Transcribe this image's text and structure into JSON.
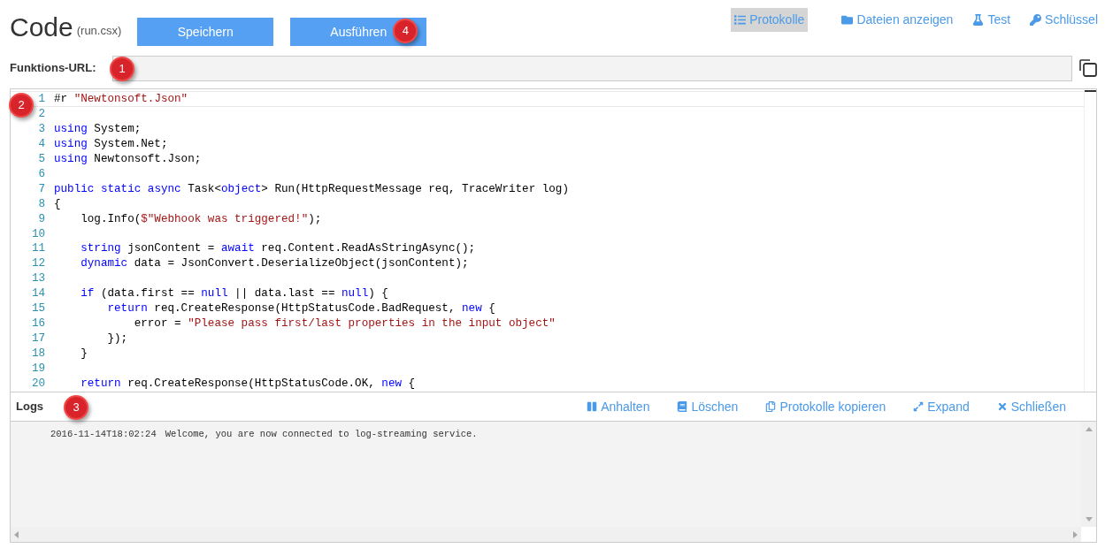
{
  "header": {
    "title": "Code",
    "subtitle": "(run.csx)",
    "buttons": [
      {
        "label": "Speichern"
      },
      {
        "label": "Ausführen",
        "callout": "4"
      }
    ]
  },
  "nav": [
    {
      "label": "Protokolle",
      "selected": true
    },
    {
      "label": "Dateien anzeigen",
      "selected": false
    },
    {
      "label": "Test",
      "selected": false
    },
    {
      "label": "Schlüssel",
      "selected": false
    }
  ],
  "function_url": {
    "label": "Funktions-URL:",
    "callout": "1"
  },
  "editor": {
    "callout": "2",
    "lines": [
      {
        "number": "1",
        "tokens": [
          {
            "kind": "plain",
            "text": "#r "
          },
          {
            "kind": "string",
            "text": "\"Newtonsoft.Json\""
          }
        ]
      },
      {
        "number": "2"
      },
      {
        "number": "3",
        "tokens": [
          {
            "kind": "keyword",
            "text": "using"
          },
          {
            "kind": "plain",
            "text": " System;"
          }
        ]
      },
      {
        "number": "4",
        "tokens": [
          {
            "kind": "keyword",
            "text": "using"
          },
          {
            "kind": "plain",
            "text": " System.Net;"
          }
        ]
      },
      {
        "number": "5",
        "tokens": [
          {
            "kind": "keyword",
            "text": "using"
          },
          {
            "kind": "plain",
            "text": " Newtonsoft.Json;"
          }
        ]
      },
      {
        "number": "6"
      },
      {
        "number": "7",
        "tokens": [
          {
            "kind": "keyword",
            "text": "public"
          },
          {
            "kind": "keyword",
            "text": " static"
          },
          {
            "kind": "keyword",
            "text": " async"
          },
          {
            "kind": "plain",
            "text": " Task<"
          },
          {
            "kind": "keyword",
            "text": "object"
          },
          {
            "kind": "plain",
            "text": "> Run(HttpRequestMessage req, TraceWriter log)"
          }
        ]
      },
      {
        "number": "8",
        "tokens": [
          {
            "kind": "plain",
            "text": "{"
          }
        ]
      },
      {
        "number": "9",
        "tokens": [
          {
            "kind": "plain",
            "text": "    log.Info("
          },
          {
            "kind": "string",
            "text": "$\"Webhook was triggered!\""
          },
          {
            "kind": "plain",
            "text": ");"
          }
        ]
      },
      {
        "number": "10"
      },
      {
        "number": "11",
        "tokens": [
          {
            "kind": "keyword",
            "text": "    string"
          },
          {
            "kind": "plain",
            "text": " jsonContent = "
          },
          {
            "kind": "keyword",
            "text": "await"
          },
          {
            "kind": "plain",
            "text": " req.Content.ReadAsStringAsync();"
          }
        ]
      },
      {
        "number": "12",
        "tokens": [
          {
            "kind": "keyword",
            "text": "    dynamic"
          },
          {
            "kind": "plain",
            "text": " data = JsonConvert.DeserializeObject(jsonContent);"
          }
        ]
      },
      {
        "number": "13"
      },
      {
        "number": "14",
        "tokens": [
          {
            "kind": "keyword",
            "text": "    if"
          },
          {
            "kind": "plain",
            "text": " (data.first == "
          },
          {
            "kind": "keyword",
            "text": "null"
          },
          {
            "kind": "plain",
            "text": " || data.last == "
          },
          {
            "kind": "keyword",
            "text": "null"
          },
          {
            "kind": "plain",
            "text": ") {"
          }
        ]
      },
      {
        "number": "15",
        "tokens": [
          {
            "kind": "keyword",
            "text": "        return"
          },
          {
            "kind": "plain",
            "text": " req.CreateResponse(HttpStatusCode.BadRequest, "
          },
          {
            "kind": "keyword",
            "text": "new"
          },
          {
            "kind": "plain",
            "text": " {"
          }
        ]
      },
      {
        "number": "16",
        "tokens": [
          {
            "kind": "plain",
            "text": "            error = "
          },
          {
            "kind": "string",
            "text": "\"Please pass first/last properties in the input object\""
          }
        ]
      },
      {
        "number": "17",
        "tokens": [
          {
            "kind": "plain",
            "text": "        });"
          }
        ]
      },
      {
        "number": "18",
        "tokens": [
          {
            "kind": "plain",
            "text": "    }"
          }
        ]
      },
      {
        "number": "19"
      },
      {
        "number": "20",
        "tokens": [
          {
            "kind": "keyword",
            "text": "    return"
          },
          {
            "kind": "plain",
            "text": " req.CreateResponse(HttpStatusCode.OK, "
          },
          {
            "kind": "keyword",
            "text": "new"
          },
          {
            "kind": "plain",
            "text": " {"
          }
        ]
      }
    ]
  },
  "logs": {
    "title": "Logs",
    "callout": "3",
    "actions": [
      {
        "label": "Anhalten"
      },
      {
        "label": "Löschen"
      },
      {
        "label": "Protokolle kopieren"
      },
      {
        "label": "Expand"
      },
      {
        "label": "Schließen"
      }
    ],
    "entries": [
      {
        "time": "2016-11-14T18:02:24",
        "message": "Welcome, you are now connected to log-streaming service."
      }
    ]
  }
}
